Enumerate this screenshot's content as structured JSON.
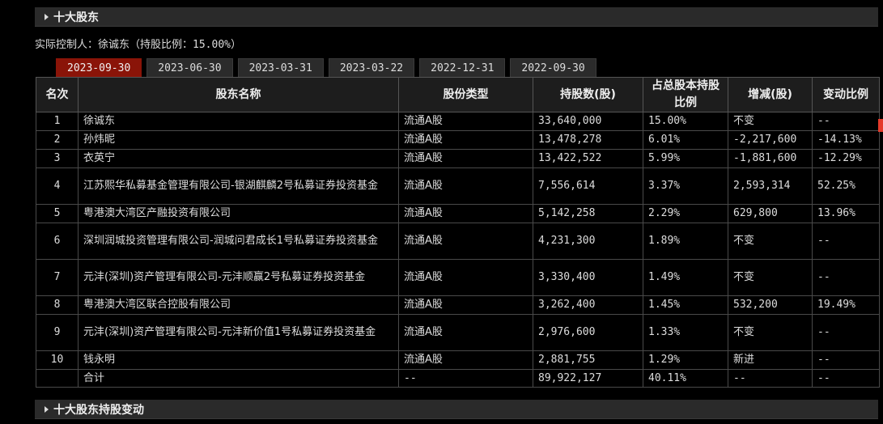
{
  "section_title": "十大股东",
  "controller": {
    "label": "实际控制人：",
    "text": "徐诚东（持股比例：15.00%）"
  },
  "tabs": [
    "2023-09-30",
    "2023-06-30",
    "2023-03-31",
    "2023-03-22",
    "2022-12-31",
    "2022-09-30"
  ],
  "active_tab": 0,
  "columns": [
    "名次",
    "股东名称",
    "股份类型",
    "持股数(股)",
    "占总股本持股比例",
    "增减(股)",
    "变动比例"
  ],
  "rows": [
    {
      "rank": "1",
      "name": "徐诚东",
      "type": "流通A股",
      "shares": "33,640,000",
      "pct": "15.00%",
      "change": "不变",
      "ratio": "--",
      "trend": "none"
    },
    {
      "rank": "2",
      "name": "孙炜昵",
      "type": "流通A股",
      "shares": "13,478,278",
      "pct": "6.01%",
      "change": "-2,217,600",
      "ratio": "-14.13%",
      "trend": "down"
    },
    {
      "rank": "3",
      "name": "衣英宁",
      "type": "流通A股",
      "shares": "13,422,522",
      "pct": "5.99%",
      "change": "-1,881,600",
      "ratio": "-12.29%",
      "trend": "down"
    },
    {
      "rank": "4",
      "name": "江苏熙华私募基金管理有限公司-银湖麒麟2号私募证券投资基金",
      "type": "流通A股",
      "shares": "7,556,614",
      "pct": "3.37%",
      "change": "2,593,314",
      "ratio": "52.25%",
      "trend": "up"
    },
    {
      "rank": "5",
      "name": "粤港澳大湾区产融投资有限公司",
      "type": "流通A股",
      "shares": "5,142,258",
      "pct": "2.29%",
      "change": "629,800",
      "ratio": "13.96%",
      "trend": "up"
    },
    {
      "rank": "6",
      "name": "深圳润城投资管理有限公司-润城问君成长1号私募证券投资基金",
      "type": "流通A股",
      "shares": "4,231,300",
      "pct": "1.89%",
      "change": "不变",
      "ratio": "--",
      "trend": "none"
    },
    {
      "rank": "7",
      "name": "元沣(深圳)资产管理有限公司-元沣顺赢2号私募证券投资基金",
      "type": "流通A股",
      "shares": "3,330,400",
      "pct": "1.49%",
      "change": "不变",
      "ratio": "--",
      "trend": "none"
    },
    {
      "rank": "8",
      "name": "粤港澳大湾区联合控股有限公司",
      "type": "流通A股",
      "shares": "3,262,400",
      "pct": "1.45%",
      "change": "532,200",
      "ratio": "19.49%",
      "trend": "up"
    },
    {
      "rank": "9",
      "name": "元沣(深圳)资产管理有限公司-元沣新价值1号私募证券投资基金",
      "type": "流通A股",
      "shares": "2,976,600",
      "pct": "1.33%",
      "change": "不变",
      "ratio": "--",
      "trend": "none"
    },
    {
      "rank": "10",
      "name": "钱永明",
      "type": "流通A股",
      "shares": "2,881,755",
      "pct": "1.29%",
      "change": "新进",
      "ratio": "--",
      "trend": "up"
    }
  ],
  "total": {
    "label": "合计",
    "type": "--",
    "shares": "89,922,127",
    "pct": "40.11%",
    "change": "--",
    "ratio": "--"
  },
  "section2_title": "十大股东持股变动",
  "colors": {
    "accent_tab": "#8a1408",
    "up": "#ff4a3a",
    "down": "#2fcc2f"
  }
}
